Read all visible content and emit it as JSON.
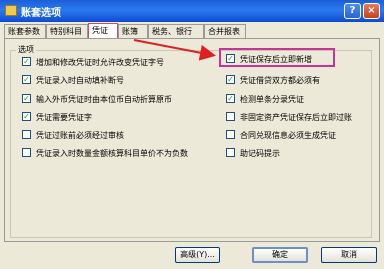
{
  "window": {
    "title": "账套选项",
    "help_label": "?",
    "close_label": "×"
  },
  "tabs": [
    {
      "label": "账套参数"
    },
    {
      "label": "特别科目"
    },
    {
      "label": "凭证"
    },
    {
      "label": "账簿"
    },
    {
      "label": "税务、银行"
    },
    {
      "label": "合并报表"
    }
  ],
  "group_label": "选项",
  "left_options": [
    {
      "label": "增加和修改凭证时允许改变凭证字号",
      "checked": true
    },
    {
      "label": "凭证录入时自动填补断号",
      "checked": true
    },
    {
      "label": "输入外币凭证时由本位币自动折算原币",
      "checked": true
    },
    {
      "label": "凭证需要凭证字",
      "checked": true
    },
    {
      "label": "凭证过账前必须经过审核",
      "checked": false
    },
    {
      "label": "凭证录入时数量金额核算科目单价不为负数",
      "checked": false
    }
  ],
  "right_options": [
    {
      "label": "凭证保存后立即新增",
      "checked": true
    },
    {
      "label": "凭证借贷双方都必须有",
      "checked": true
    },
    {
      "label": "检测单条分录凭证",
      "checked": true
    },
    {
      "label": "非固定资产凭证保存后立即过账",
      "checked": false
    },
    {
      "label": "合同兑现信息必须生成凭证",
      "checked": false
    },
    {
      "label": "助记码提示",
      "checked": false
    }
  ],
  "buttons": {
    "advanced": "高级(Y)...",
    "ok": "确定",
    "cancel": "取消"
  },
  "colors": {
    "highlight": "#c8329a",
    "arrow": "#e02020"
  }
}
